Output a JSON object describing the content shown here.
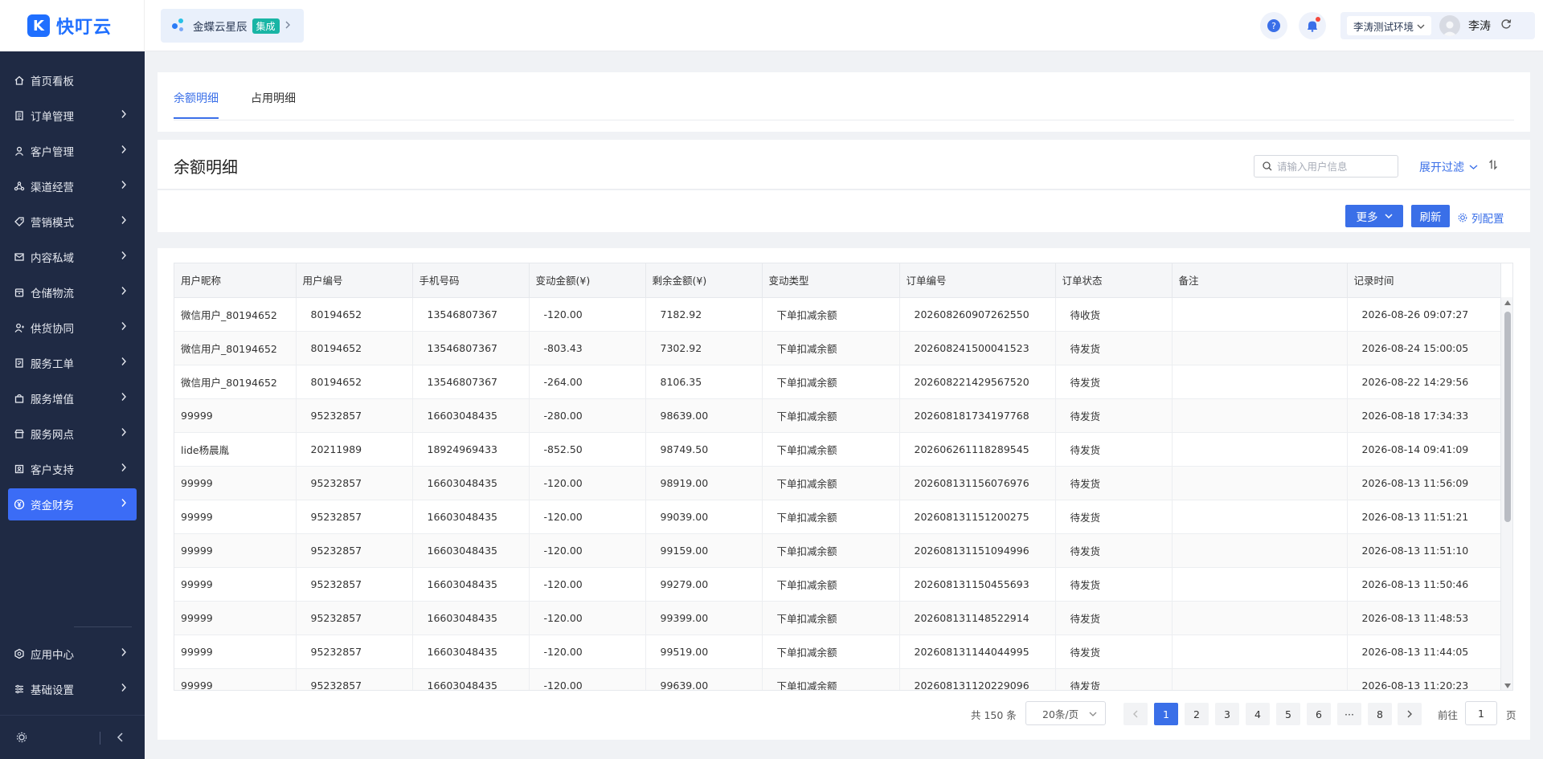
{
  "brand": {
    "logo_letter": "K",
    "name": "快叮云",
    "color": "#1f6fff"
  },
  "header": {
    "integration": {
      "name": "金蝶云星辰",
      "tag": "集成"
    },
    "environment": "李涛测试环境",
    "user_name": "李涛"
  },
  "sidebar": {
    "items": [
      {
        "label": "首页看板",
        "icon": "home-icon",
        "has_arrow": false
      },
      {
        "label": "订单管理",
        "icon": "order-icon",
        "has_arrow": true
      },
      {
        "label": "客户管理",
        "icon": "customer-icon",
        "has_arrow": true
      },
      {
        "label": "渠道经营",
        "icon": "channel-icon",
        "has_arrow": true
      },
      {
        "label": "营销模式",
        "icon": "tag-icon",
        "has_arrow": true
      },
      {
        "label": "内容私域",
        "icon": "content-icon",
        "has_arrow": true
      },
      {
        "label": "仓储物流",
        "icon": "warehouse-icon",
        "has_arrow": true
      },
      {
        "label": "供货协同",
        "icon": "supply-icon",
        "has_arrow": true
      },
      {
        "label": "服务工单",
        "icon": "ticket-icon",
        "has_arrow": true
      },
      {
        "label": "服务增值",
        "icon": "bag-icon",
        "has_arrow": true
      },
      {
        "label": "服务网点",
        "icon": "store-icon",
        "has_arrow": true
      },
      {
        "label": "客户支持",
        "icon": "support-icon",
        "has_arrow": true
      },
      {
        "label": "资金财务",
        "icon": "yuan-icon",
        "has_arrow": true,
        "active": true
      }
    ],
    "bottom_items": [
      {
        "label": "应用中心",
        "icon": "app-center-icon"
      },
      {
        "label": "基础设置",
        "icon": "settings-list-icon"
      }
    ],
    "accent_color": "#3b6cf6"
  },
  "tabs": [
    {
      "label": "余额明细",
      "active": true
    },
    {
      "label": "占用明细",
      "active": false
    }
  ],
  "filter": {
    "title": "余额明细",
    "search_placeholder": "请输入用户信息",
    "expand_label": "展开过滤"
  },
  "toolbar": {
    "more_label": "更多",
    "refresh_label": "刷新",
    "column_config_label": "列配置"
  },
  "table": {
    "columns": [
      "用户昵称",
      "用户编号",
      "手机号码",
      "变动金额(¥)",
      "剩余金额(¥)",
      "变动类型",
      "订单编号",
      "订单状态",
      "备注",
      "记录时间"
    ],
    "rows": [
      [
        "微信用户_80194652",
        "80194652",
        "13546807367",
        "-120.00",
        "7182.92",
        "下单扣减余额",
        "202608260907262550",
        "待收货",
        "",
        "2026-08-26 09:07:27"
      ],
      [
        "微信用户_80194652",
        "80194652",
        "13546807367",
        "-803.43",
        "7302.92",
        "下单扣减余额",
        "202608241500041523",
        "待发货",
        "",
        "2026-08-24 15:00:05"
      ],
      [
        "微信用户_80194652",
        "80194652",
        "13546807367",
        "-264.00",
        "8106.35",
        "下单扣减余额",
        "202608221429567520",
        "待发货",
        "",
        "2026-08-22 14:29:56"
      ],
      [
        "99999",
        "95232857",
        "16603048435",
        "-280.00",
        "98639.00",
        "下单扣减余额",
        "202608181734197768",
        "待发货",
        "",
        "2026-08-18 17:34:33"
      ],
      [
        "lide杨晨胤",
        "20211989",
        "18924969433",
        "-852.50",
        "98749.50",
        "下单扣减余额",
        "202606261118289545",
        "待发货",
        "",
        "2026-08-14 09:41:09"
      ],
      [
        "99999",
        "95232857",
        "16603048435",
        "-120.00",
        "98919.00",
        "下单扣减余额",
        "202608131156076976",
        "待发货",
        "",
        "2026-08-13 11:56:09"
      ],
      [
        "99999",
        "95232857",
        "16603048435",
        "-120.00",
        "99039.00",
        "下单扣减余额",
        "202608131151200275",
        "待发货",
        "",
        "2026-08-13 11:51:21"
      ],
      [
        "99999",
        "95232857",
        "16603048435",
        "-120.00",
        "99159.00",
        "下单扣减余额",
        "202608131151094996",
        "待发货",
        "",
        "2026-08-13 11:51:10"
      ],
      [
        "99999",
        "95232857",
        "16603048435",
        "-120.00",
        "99279.00",
        "下单扣减余额",
        "202608131150455693",
        "待发货",
        "",
        "2026-08-13 11:50:46"
      ],
      [
        "99999",
        "95232857",
        "16603048435",
        "-120.00",
        "99399.00",
        "下单扣减余额",
        "202608131148522914",
        "待发货",
        "",
        "2026-08-13 11:48:53"
      ],
      [
        "99999",
        "95232857",
        "16603048435",
        "-120.00",
        "99519.00",
        "下单扣减余额",
        "202608131144044995",
        "待发货",
        "",
        "2026-08-13 11:44:05"
      ],
      [
        "99999",
        "95232857",
        "16603048435",
        "-120.00",
        "99639.00",
        "下单扣减余额",
        "202608131120229096",
        "待发货",
        "",
        "2026-08-13 11:20:23"
      ]
    ]
  },
  "pagination": {
    "total_label": "共 150 条",
    "page_size": "20条/页",
    "pages": [
      "1",
      "2",
      "3",
      "4",
      "5",
      "6",
      "···",
      "8"
    ],
    "current_page": "1",
    "goto_label": "前往",
    "goto_value": "1",
    "page_label": "页"
  }
}
